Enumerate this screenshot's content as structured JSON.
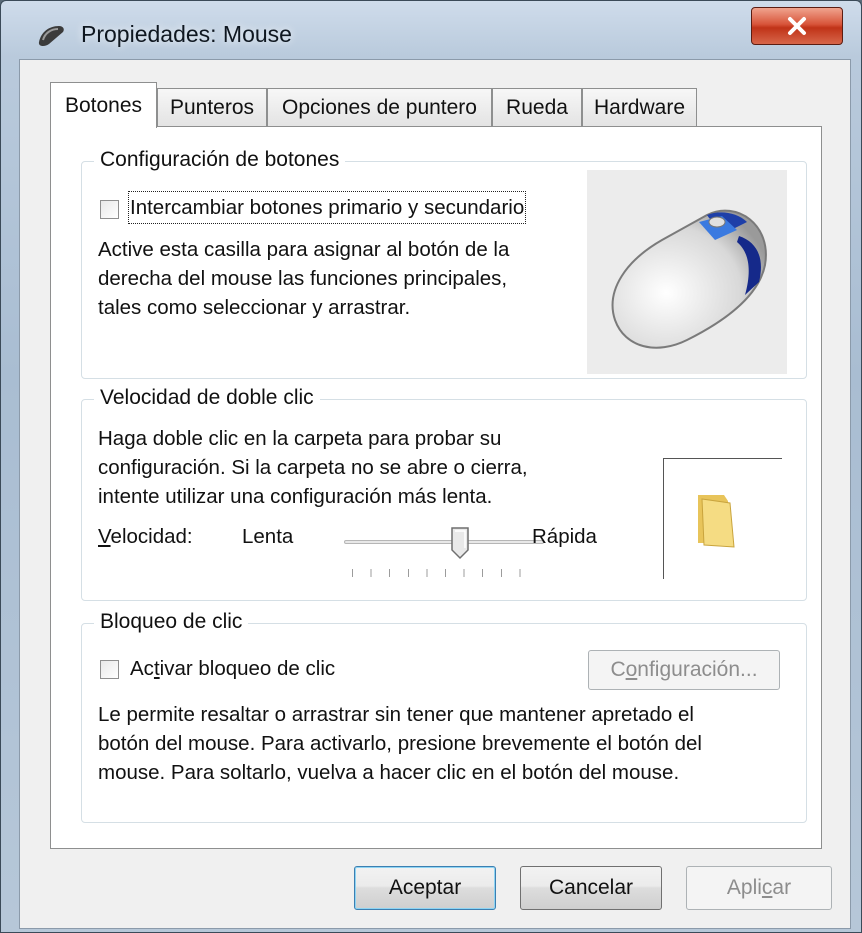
{
  "window": {
    "title": "Propiedades: Mouse",
    "close_icon": "close-icon"
  },
  "tabs": [
    {
      "label": "Botones",
      "active": true
    },
    {
      "label": "Punteros",
      "active": false
    },
    {
      "label": "Opciones de puntero",
      "active": false
    },
    {
      "label": "Rueda",
      "active": false
    },
    {
      "label": "Hardware",
      "active": false
    }
  ],
  "buttons_config": {
    "legend": "Configuración de botones",
    "swap_checkbox_label": "Intercambiar botones primario y secundario",
    "swap_checked": false,
    "description_lines": [
      "Active esta casilla para asignar al botón de la",
      "derecha del mouse las funciones principales,",
      "tales como seleccionar y arrastrar."
    ]
  },
  "double_click": {
    "legend": "Velocidad de doble clic",
    "description_lines": [
      "Haga doble clic en la carpeta para probar su",
      "configuración. Si la carpeta no se abre o cierra,",
      "intente utilizar una configuración más lenta."
    ],
    "speed_label_first": "V",
    "speed_label_rest": "elocidad:",
    "slow_label": "Lenta",
    "fast_label": "Rápida",
    "speed_fraction": 0.6,
    "tick_count": 11
  },
  "click_lock": {
    "legend": "Bloqueo de clic",
    "checkbox_label_pre": "Ac",
    "checkbox_label_u": "t",
    "checkbox_label_post": "ivar bloqueo de clic",
    "checked": false,
    "settings_pre": "C",
    "settings_u": "o",
    "settings_post": "nfiguración...",
    "description_lines": [
      "Le permite resaltar o arrastrar sin tener que mantener apretado el",
      "botón del mouse. Para activarlo, presione brevemente el botón del",
      "mouse. Para soltarlo, vuelva a hacer clic en el botón del mouse."
    ]
  },
  "footer": {
    "ok_label": "Aceptar",
    "cancel_label": "Cancelar",
    "apply_pre": "Apli",
    "apply_u": "c",
    "apply_post": "ar"
  },
  "colors": {
    "accent_default_button": "#3c7fb1",
    "close_button": "#c03318",
    "mouse_accent": "#1e3fa8"
  }
}
